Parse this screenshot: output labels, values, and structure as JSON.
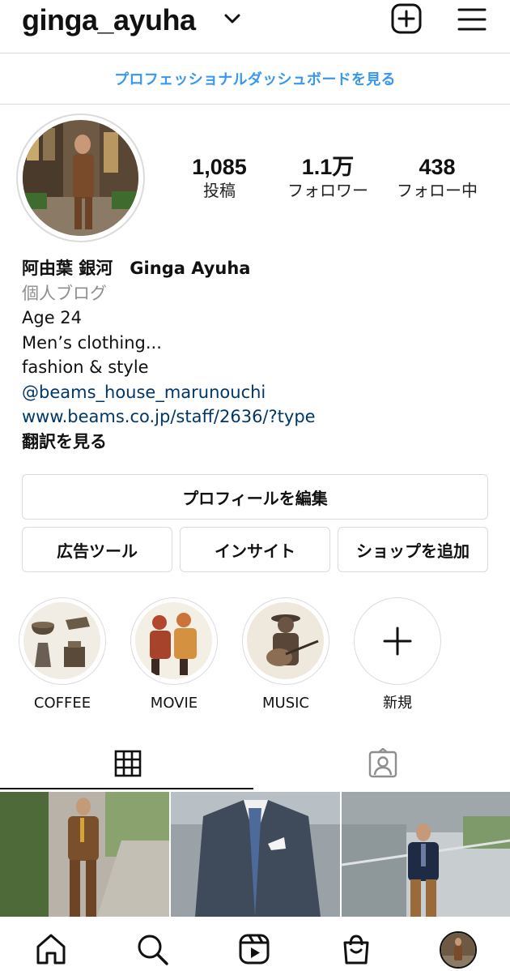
{
  "header": {
    "username": "ginga_ayuha"
  },
  "dashboard_link": "プロフェッショナルダッシュボードを見る",
  "stats": [
    {
      "value": "1,085",
      "label": "投稿"
    },
    {
      "value": "1.1万",
      "label": "フォロワー"
    },
    {
      "value": "438",
      "label": "フォロー中"
    }
  ],
  "bio": {
    "name": "阿由葉 銀河　Ginga Ayuha",
    "category": "個人ブログ",
    "lines": [
      "Age 24",
      "Men’s clothing...",
      "fashion & style"
    ],
    "mention": "@beams_house_marunouchi",
    "url": "www.beams.co.jp/staff/2636/?type",
    "translate": "翻訳を見る"
  },
  "buttons": {
    "edit_profile": "プロフィールを編集",
    "ad_tools": "広告ツール",
    "insights": "インサイト",
    "add_shop": "ショップを追加"
  },
  "highlights": [
    {
      "label": "COFFEE"
    },
    {
      "label": "MOVIE"
    },
    {
      "label": "MUSIC"
    },
    {
      "label": "新規"
    }
  ],
  "tabs": [
    {
      "icon": "grid-icon",
      "active": true
    },
    {
      "icon": "tagged-person-icon",
      "active": false
    }
  ],
  "nav": [
    "home-icon",
    "search-icon",
    "reels-icon",
    "shop-icon",
    "profile-avatar"
  ],
  "colors": {
    "link_blue": "#3897f0",
    "bio_link": "#00376b",
    "border": "#dbdbdb"
  }
}
